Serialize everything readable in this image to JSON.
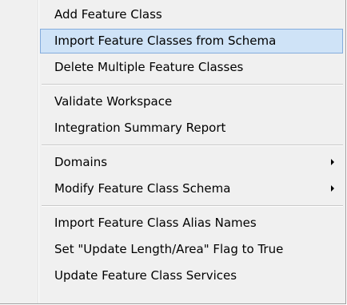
{
  "menu": {
    "groups": [
      {
        "items": [
          {
            "label": "Add Feature Class"
          },
          {
            "label": "Import Feature Classes from Schema"
          },
          {
            "label": "Delete Multiple Feature Classes"
          }
        ]
      },
      {
        "items": [
          {
            "label": "Validate Workspace"
          },
          {
            "label": "Integration Summary Report"
          }
        ]
      },
      {
        "items": [
          {
            "label": "Domains",
            "submenu_arrow": "chevron-right-icon"
          },
          {
            "label": "Modify Feature Class Schema",
            "submenu_arrow": "chevron-right-icon"
          }
        ]
      },
      {
        "items": [
          {
            "label": "Import Feature Class Alias Names"
          },
          {
            "label": "Set \"Update Length/Area\" Flag to True"
          },
          {
            "label": "Update Feature Class Services"
          }
        ]
      }
    ],
    "highlighted_item": "Import Feature Classes from Schema",
    "colors": {
      "background": "#f0f0f0",
      "highlight_fill": "#cfe3f7",
      "highlight_border": "#84acdd",
      "separator": "#c9c9c9"
    }
  }
}
